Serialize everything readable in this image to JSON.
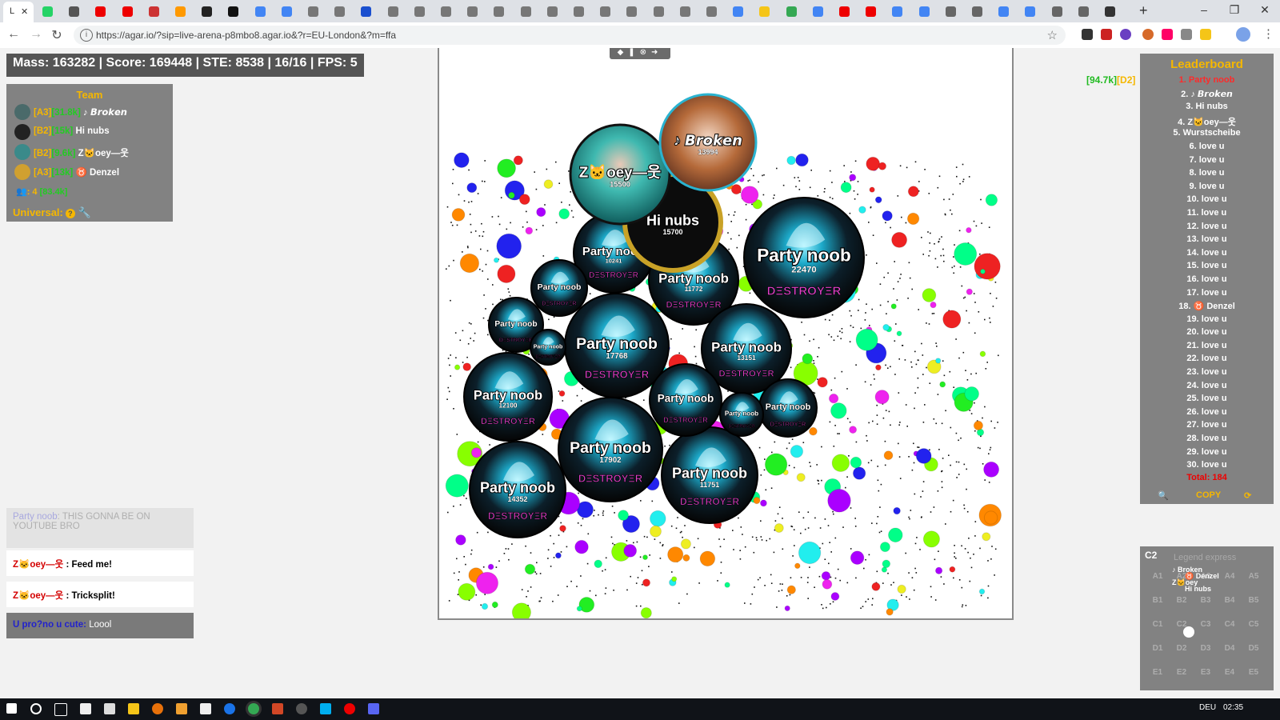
{
  "browser": {
    "active_tab_label": "L",
    "url": "https://agar.io/?sip=live-arena-p8mbo8.agar.io&?r=EU-London&?m=ffa",
    "tab_favicon_colors": [
      "#25d366",
      "#555",
      "#e00",
      "#e00",
      "#c33",
      "#f90",
      "#222",
      "#111",
      "#4285f4",
      "#4285f4",
      "#777",
      "#777",
      "#1a4fcf",
      "#777",
      "#777",
      "#777",
      "#777",
      "#777",
      "#777",
      "#777",
      "#777",
      "#777",
      "#777",
      "#777",
      "#777",
      "#777",
      "#4285f4",
      "#f5c518",
      "#34a853",
      "#4285f4",
      "#e00",
      "#e00",
      "#4285f4",
      "#4285f4",
      "#666",
      "#666",
      "#4285f4",
      "#4285f4",
      "#666",
      "#666",
      "#333"
    ]
  },
  "hud": {
    "stats_text": "Mass: 163282 | Score: 169448 | STE: 8538 | 16/16 | FPS: 5",
    "server_tag_mass": "[94.7k]",
    "server_tag_region": "[D2]"
  },
  "team": {
    "title": "Team",
    "members": [
      {
        "level": "[A3]",
        "mass": "[31.8k]",
        "name": "♪ 𝘽𝙧𝙤𝙠𝙚𝙣",
        "avatar_color": "#4a6a6a"
      },
      {
        "level": "[B2]",
        "mass": "[15k]",
        "name": "Hi nubs",
        "avatar_color": "#222"
      },
      {
        "level": "[B2]",
        "mass": "[9.6k]",
        "name": "Z🐱oey—웃",
        "avatar_color": "#3a8a8a"
      },
      {
        "level": "[A3]",
        "mass": "[13k]",
        "name": "♉ Denzel",
        "avatar_color": "#d0a030"
      }
    ],
    "totals_prefix": "👥: 4",
    "totals_mass": "[83.4k]",
    "universal_label": "Universal:"
  },
  "chat": {
    "faded_sender": "Party noob",
    "faded_message": "THIS GONNA BE ON YOUTUBE BRO",
    "lines": [
      {
        "sender": "Z🐱oey—웃",
        "message": "Feed me!"
      },
      {
        "sender": "Z🐱oey—웃",
        "message": "Tricksplit!"
      }
    ],
    "input_sender": "U pro?no u cute:",
    "input_value": "Loool"
  },
  "leaderboard": {
    "title": "Leaderboard",
    "entries": [
      "1. Party noob",
      "2. ♪ 𝘽𝙧𝙤𝙠𝙚𝙣",
      "3. Hi nubs",
      "4. Z🐱oey—웃",
      "5. Wurstscheibe",
      "6. love u",
      "7. love u",
      "8. love u",
      "9. love u",
      "10. love u",
      "11. love u",
      "12. love u",
      "13. love u",
      "14. love u",
      "15. love u",
      "16. love u",
      "17. love u",
      "18. ♉ Denzel",
      "19. love u",
      "20. love u",
      "21. love u",
      "22. love u",
      "23. love u",
      "24. love u",
      "25. love u",
      "26. love u",
      "27. love u",
      "28. love u",
      "29. love u",
      "30. love u"
    ],
    "total": "Total: 184",
    "copy_label": "COPY"
  },
  "minimap": {
    "current_cell": "C2",
    "server_name": "Legend express",
    "rows": [
      "A",
      "B",
      "C",
      "D",
      "E"
    ],
    "cols": [
      "1",
      "2",
      "3",
      "4",
      "5"
    ],
    "player_labels": [
      "♪ Broken",
      "♉ Denzel",
      "Z🐱oey",
      "Hi nubs"
    ]
  },
  "cells": {
    "clan_tag": "DΞSTROYΞR",
    "players": [
      {
        "name": "Z🐱oey—웃",
        "mass": "15500",
        "skin": "teal"
      },
      {
        "name": "♪ 𝘽𝙧𝙤𝙠𝙚𝙣",
        "mass": "13994",
        "skin": "anime"
      },
      {
        "name": "Hi nubs",
        "mass": "15700",
        "skin": "gold"
      },
      {
        "name": "Party noob",
        "mass": "22470",
        "skin": "clan"
      },
      {
        "name": "Party noob",
        "mass": "17768",
        "skin": "clan"
      },
      {
        "name": "Party noob",
        "mass": "17902",
        "skin": "clan"
      },
      {
        "name": "Party noob",
        "mass": "11772",
        "skin": "clan"
      },
      {
        "name": "Party noob",
        "mass": "14352",
        "skin": "clan"
      },
      {
        "name": "Party noob",
        "mass": "13151",
        "skin": "clan"
      },
      {
        "name": "Party noob",
        "mass": "12100",
        "skin": "clan"
      },
      {
        "name": "Party noob",
        "mass": "11751",
        "skin": "clan"
      },
      {
        "name": "Party noob",
        "mass": "10241",
        "skin": "clan"
      },
      {
        "name": "Party noob",
        "mass": "",
        "skin": "clan"
      },
      {
        "name": "Party noob",
        "mass": "",
        "skin": "clan"
      },
      {
        "name": "Party noob",
        "mass": "",
        "skin": "clan"
      },
      {
        "name": "Party noob",
        "mass": "",
        "skin": "clan"
      },
      {
        "name": "Party noob",
        "mass": "",
        "skin": "clan"
      },
      {
        "name": "Party noob",
        "mass": "",
        "skin": "clan"
      }
    ],
    "food_colors": [
      "#22ee22",
      "#ee2222",
      "#2222ee",
      "#ee22ee",
      "#22eeee",
      "#eeee22",
      "#ff8800",
      "#88ff00",
      "#00ff88",
      "#aa00ff"
    ]
  },
  "taskbar": {
    "lang": "DEU",
    "time": "02:35"
  }
}
